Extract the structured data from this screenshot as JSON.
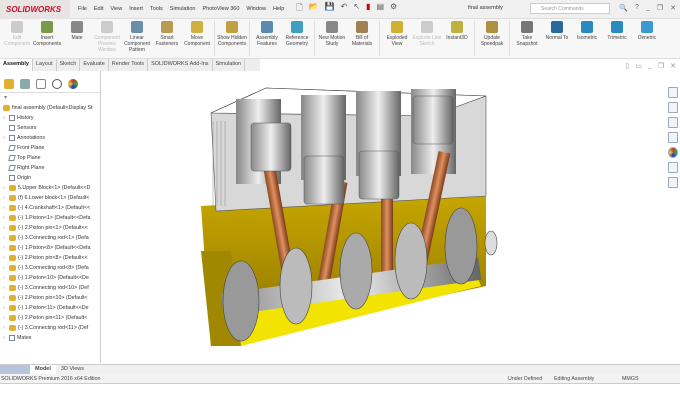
{
  "app": {
    "logo": "SOLIDWORKS",
    "document_title": "final assembly",
    "search_placeholder": "Search Commands"
  },
  "menu": [
    "File",
    "Edit",
    "View",
    "Insert",
    "Tools",
    "Simulation",
    "PhotoView 360",
    "Window",
    "Help"
  ],
  "ribbon": [
    {
      "label": "Edit Component",
      "disabled": true,
      "color": "#ccc"
    },
    {
      "label": "Insert Components",
      "color": "#7a9a4a"
    },
    {
      "label": "Mate",
      "color": "#888"
    },
    {
      "label": "Component Preview Window",
      "disabled": true,
      "color": "#ccc"
    },
    {
      "label": "Linear Component Pattern",
      "color": "#6b8fa8"
    },
    {
      "label": "Smart Fasteners",
      "color": "#b89a50"
    },
    {
      "label": "Move Component",
      "color": "#d0b040"
    },
    {
      "label": "Show Hidden Components",
      "color": "#c0a040"
    },
    {
      "label": "Assembly Features",
      "color": "#5a8ab0"
    },
    {
      "label": "Reference Geometry",
      "color": "#40a0c0"
    },
    {
      "label": "New Motion Study",
      "color": "#888"
    },
    {
      "label": "Bill of Materials",
      "color": "#a08050"
    },
    {
      "label": "Exploded View",
      "color": "#d0b030"
    },
    {
      "label": "Explode Line Sketch",
      "disabled": true,
      "color": "#ccc"
    },
    {
      "label": "Instant3D",
      "color": "#c0b040"
    },
    {
      "label": "Update Speedpak",
      "color": "#b09040"
    },
    {
      "label": "Take Snapshot",
      "color": "#777"
    },
    {
      "label": "Normal To",
      "color": "#2a6a9a"
    },
    {
      "label": "Isometric",
      "color": "#2a8ac0"
    },
    {
      "label": "Trimetric",
      "color": "#2a8ac0"
    },
    {
      "label": "Dimetric",
      "color": "#3a9ad0"
    }
  ],
  "tabs": [
    "Assembly",
    "Layout",
    "Sketch",
    "Evaluate",
    "Render Tools",
    "SOLIDWORKS Add-Ins",
    "Simulation"
  ],
  "tree": {
    "root": "final assembly  (Default<Display St",
    "items": [
      {
        "label": "History",
        "type": "folder",
        "exp": true
      },
      {
        "label": "Sensors",
        "type": "folder"
      },
      {
        "label": "Annotations",
        "type": "folder",
        "exp": true
      },
      {
        "label": "Front Plane",
        "type": "plane"
      },
      {
        "label": "Top Plane",
        "type": "plane"
      },
      {
        "label": "Right Plane",
        "type": "plane"
      },
      {
        "label": "Origin",
        "type": "origin"
      },
      {
        "label": "5.Upper Block<1> (Default<<D",
        "type": "part",
        "exp": true
      },
      {
        "label": "(f) 6.Lower block<1> (Default<",
        "type": "part",
        "exp": true
      },
      {
        "label": "(-) 4.Crankshaft<1> (Default<<",
        "type": "part",
        "exp": true
      },
      {
        "label": "(-) 1.Piston<1> (Default<<Defa",
        "type": "part",
        "exp": true
      },
      {
        "label": "(-) 2.Piston pin<1> (Default<<",
        "type": "part",
        "exp": true
      },
      {
        "label": "(-) 3.Connecting rod<1> (Defa",
        "type": "part",
        "exp": true
      },
      {
        "label": "(-) 1.Piston<8> (Default<<Defa",
        "type": "part",
        "exp": true
      },
      {
        "label": "(-) 2.Piston pin<8> (Default<<",
        "type": "part",
        "exp": true
      },
      {
        "label": "(-) 3.Connecting rod<8> (Defa",
        "type": "part",
        "exp": true
      },
      {
        "label": "(-) 1.Piston<10> (Default<<De",
        "type": "part",
        "exp": true
      },
      {
        "label": "(-) 3.Connecting rod<10> (Def",
        "type": "part",
        "exp": true
      },
      {
        "label": "(-) 2.Piston pin<10> (Default<",
        "type": "part",
        "exp": true
      },
      {
        "label": "(-) 1.Piston<11> (Default<<De",
        "type": "part",
        "exp": true
      },
      {
        "label": "(-) 2.Piston pin<11> (Default<",
        "type": "part",
        "exp": true
      },
      {
        "label": "(-) 3.Connecting rod<11> (Def",
        "type": "part",
        "exp": true
      },
      {
        "label": "Mates",
        "type": "folder",
        "exp": true
      }
    ]
  },
  "bottom_tabs": [
    "Model",
    "3D Views"
  ],
  "status": {
    "edition": "SOLIDWORKS Premium 2016 x64 Edition",
    "state": "Under Defined",
    "mode": "Editing Assembly",
    "units": "MMGS"
  }
}
